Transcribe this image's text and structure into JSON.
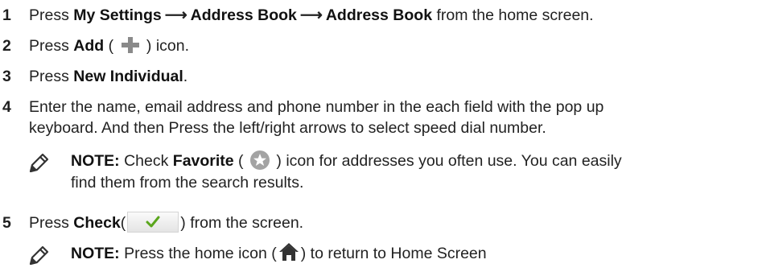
{
  "steps": [
    {
      "num": "1",
      "press": "Press ",
      "menu": [
        "My Settings",
        "Address Book",
        "Address Book"
      ],
      "arrow": "⟶",
      "tail": " from the home screen."
    },
    {
      "num": "2",
      "press": "Press ",
      "bold": "Add",
      "open": " ( ",
      "close": " ) icon."
    },
    {
      "num": "3",
      "press": "Press ",
      "bold": "New Individual",
      "tail": "."
    },
    {
      "num": "4",
      "line1": "Enter the name, email address and phone number in the each field with the pop up",
      "line2": "keyboard. And then Press the left/right arrows to select speed dial number."
    },
    {
      "num": "5",
      "press": "Press ",
      "bold": "Check",
      "open": "(",
      "close": ") from the screen."
    }
  ],
  "notes": [
    {
      "label": "NOTE:",
      "pre": " Check ",
      "bold": "Favorite",
      "open": " ( ",
      "close": " ) icon for addresses you often use. You can easily",
      "line2": "find them from the search results."
    },
    {
      "label": "NOTE:",
      "pre": " Press the home icon (",
      "close": ") to return to Home Screen"
    }
  ],
  "icons": {
    "add": "plus-icon",
    "favorite": "star-icon",
    "check": "checkmark-icon",
    "home": "home-icon",
    "note": "pencil-note-icon"
  },
  "colors": {
    "plus": "#8a8a8a",
    "check": "#5aa61c",
    "star_bg": "#9a9a9a"
  }
}
